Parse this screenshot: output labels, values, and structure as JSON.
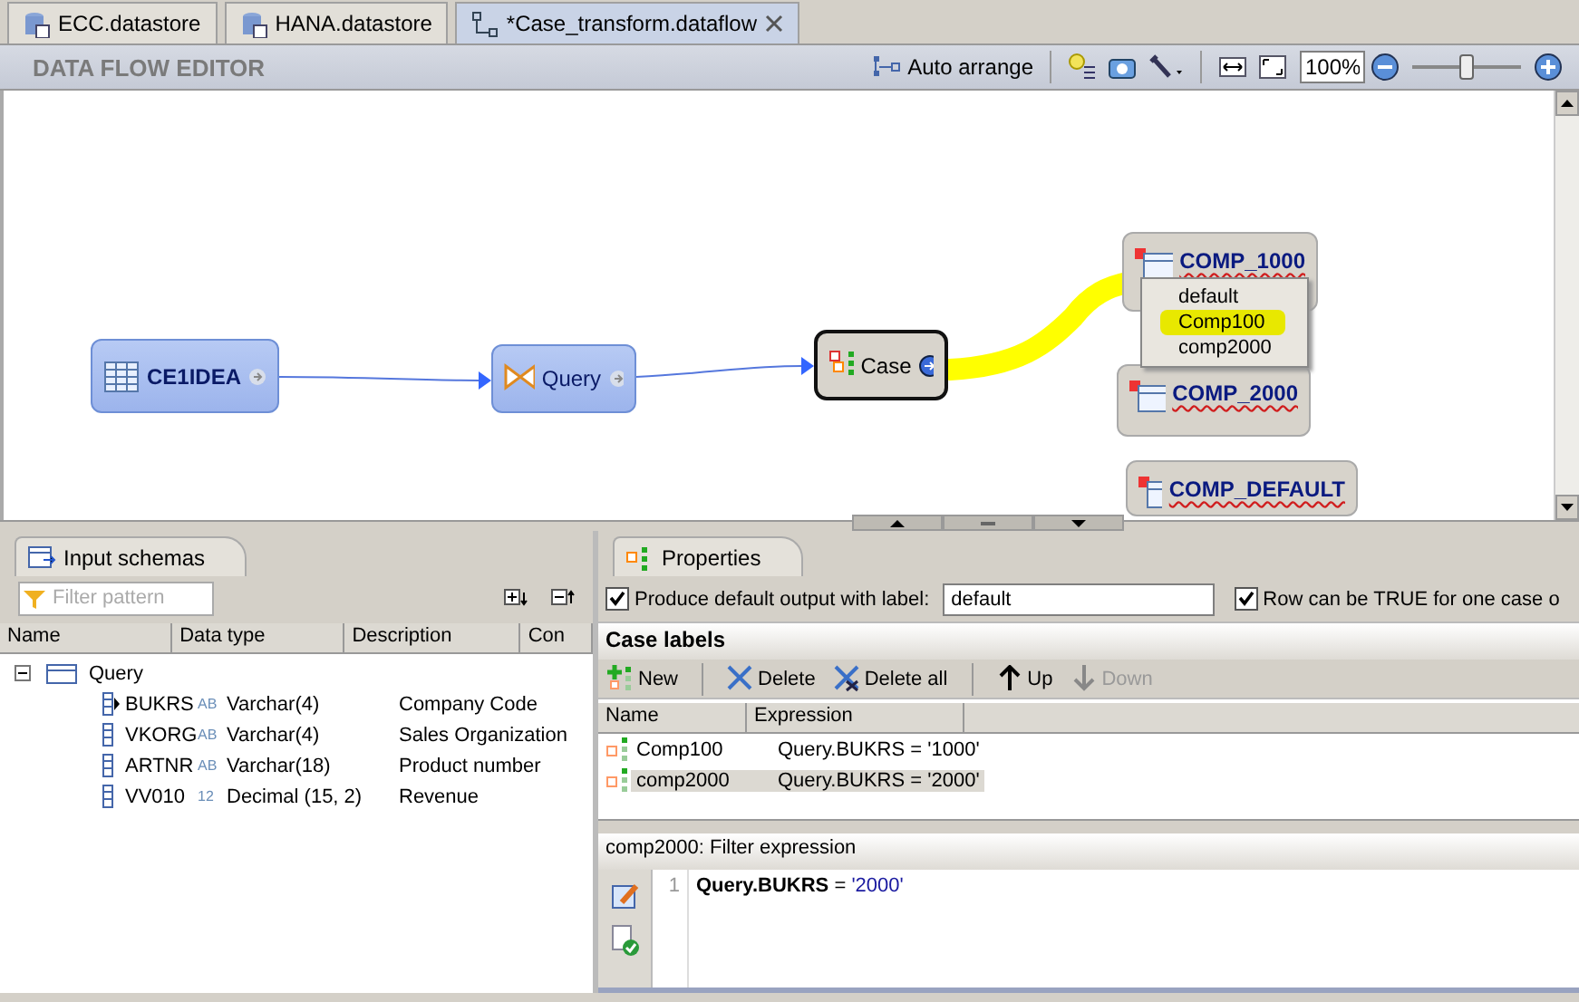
{
  "tabs": [
    {
      "label": "ECC.datastore",
      "kind": "datastore",
      "selected": false
    },
    {
      "label": "HANA.datastore",
      "kind": "datastore",
      "selected": false
    },
    {
      "label": "*Case_transform.dataflow",
      "kind": "dataflow",
      "selected": true,
      "closable": true
    }
  ],
  "toolbar": {
    "title": "DATA FLOW EDITOR",
    "auto_arrange": "Auto arrange",
    "zoom": "100%",
    "zoom_slider": {
      "level": 0.5
    }
  },
  "canvas": {
    "nodes": [
      {
        "kind": "source",
        "label": "CE1IDEA"
      },
      {
        "kind": "query",
        "label": "Query"
      },
      {
        "kind": "case",
        "label": "Case"
      },
      {
        "kind": "target",
        "label": "COMP_1000"
      },
      {
        "kind": "target",
        "label": "COMP_2000"
      },
      {
        "kind": "target",
        "label": "COMP_DEFAULT"
      }
    ],
    "popup": [
      {
        "label": "default",
        "selected": false
      },
      {
        "label": "Comp100",
        "selected": true
      },
      {
        "label": "comp2000",
        "selected": false
      }
    ]
  },
  "input_schemas": {
    "title": "Input schemas",
    "filter_placeholder": "Filter pattern",
    "columns": [
      "Name",
      "Data type",
      "Description",
      "Con"
    ],
    "tree": [
      {
        "name": "Query",
        "expanded": true,
        "children": [
          {
            "name": "BUKRS",
            "type_tag": "AB",
            "data_type": "Varchar(4)",
            "description": "Company Code",
            "marked": true
          },
          {
            "name": "VKORG",
            "type_tag": "AB",
            "data_type": "Varchar(4)",
            "description": "Sales Organization",
            "marked": false
          },
          {
            "name": "ARTNR",
            "type_tag": "AB",
            "data_type": "Varchar(18)",
            "description": "Product number",
            "marked": false
          },
          {
            "name": "VV010",
            "type_tag": "12",
            "data_type": "Decimal (15, 2)",
            "description": "Revenue",
            "marked": false
          }
        ]
      }
    ]
  },
  "properties": {
    "title": "Properties",
    "default_output": {
      "label": "Produce default output with label:",
      "checked": true,
      "value": "default"
    },
    "row_true": {
      "label": "Row can be TRUE for one case o",
      "checked": true
    },
    "case_labels": {
      "title": "Case labels",
      "actions": [
        {
          "kind": "new",
          "label": "New",
          "disabled": false
        },
        {
          "kind": "delete",
          "label": "Delete",
          "disabled": false
        },
        {
          "kind": "delete_all",
          "label": "Delete all",
          "disabled": false
        },
        {
          "kind": "up",
          "label": "Up",
          "disabled": false
        },
        {
          "kind": "down",
          "label": "Down",
          "disabled": true
        }
      ],
      "columns": [
        "Name",
        "Expression"
      ],
      "rows": [
        {
          "name": "Comp100",
          "expression": "Query.BUKRS = '1000'",
          "selected": false
        },
        {
          "name": "comp2000",
          "expression": "Query.BUKRS = '2000'",
          "selected": true
        }
      ]
    },
    "filter": {
      "title": "comp2000: Filter expression",
      "line_number": "1",
      "code": [
        {
          "kind": "field",
          "text": "Query.BUKRS"
        },
        {
          "kind": "operator",
          "text": " = "
        },
        {
          "kind": "string",
          "text": "'2000'"
        }
      ]
    }
  }
}
